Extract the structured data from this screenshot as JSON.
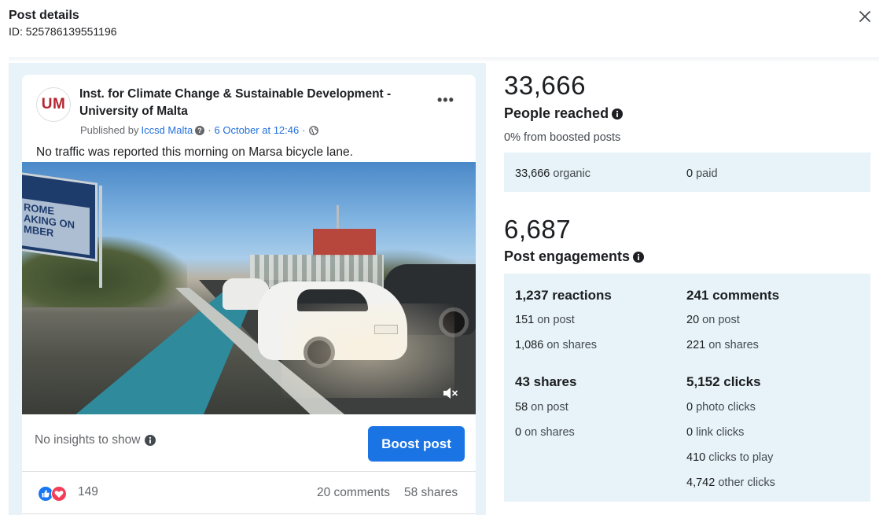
{
  "header": {
    "title": "Post details",
    "id_text": "ID: 525786139551196"
  },
  "post": {
    "avatar_text": "UM",
    "page_name": "Inst. for Climate Change & Sustainable Development - University of Malta",
    "published_by_prefix": "Published by",
    "publisher": "Iccsd Malta",
    "date": "6 October at 12:46",
    "separator": "·",
    "text": "No traffic was reported this morning on Marsa bicycle lane.",
    "billboard_text": "ROME\nAKING ON\nMBER",
    "no_insights": "No insights to show",
    "boost_label": "Boost post",
    "reaction_count": "149",
    "comments_text": "20 comments",
    "shares_text": "58 shares"
  },
  "reach": {
    "total": "33,666",
    "title": "People reached",
    "subtitle": "0% from boosted posts",
    "organic_value": "33,666",
    "organic_label": "organic",
    "paid_value": "0",
    "paid_label": "paid"
  },
  "engagement": {
    "total": "6,687",
    "title": "Post engagements",
    "reactions": {
      "head": "1,237 reactions",
      "on_post_value": "151",
      "on_post_label": "on post",
      "on_shares_value": "1,086",
      "on_shares_label": "on shares"
    },
    "comments": {
      "head": "241 comments",
      "on_post_value": "20",
      "on_post_label": "on post",
      "on_shares_value": "221",
      "on_shares_label": "on shares"
    },
    "shares": {
      "head": "43 shares",
      "on_post_value": "58",
      "on_post_label": "on post",
      "on_shares_value": "0",
      "on_shares_label": "on shares"
    },
    "clicks": {
      "head": "5,152 clicks",
      "photo_value": "0",
      "photo_label": "photo clicks",
      "link_value": "0",
      "link_label": "link clicks",
      "play_value": "410",
      "play_label": "clicks to play",
      "other_value": "4,742",
      "other_label": "other clicks"
    }
  },
  "icons": {
    "close": "close-icon",
    "more": "more-options-icon",
    "info": "info-icon",
    "globe": "globe-icon",
    "mute": "muted-speaker-icon",
    "like": "like-reaction-icon",
    "love": "love-reaction-icon"
  },
  "colors": {
    "accent": "#1b74e4",
    "link": "#216fdb",
    "panel_bg": "#e7f3f8",
    "avatar_text": "#b4252f"
  }
}
